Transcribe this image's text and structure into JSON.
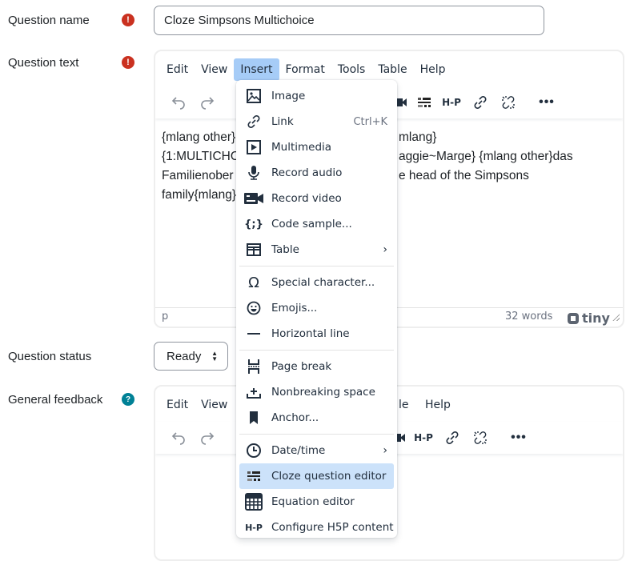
{
  "form": {
    "question_name": {
      "label": "Question name",
      "value": "Cloze Simpsons Multichoice",
      "required_icon": "exclamation-icon"
    },
    "question_text": {
      "label": "Question text",
      "required_icon": "exclamation-icon",
      "menubar": [
        "Edit",
        "View",
        "Insert",
        "Format",
        "Tools",
        "Table",
        "Help"
      ],
      "active_menu": "Insert",
      "content_lines": [
        "{mlang other}",
        "mlang}",
        "{1:MULTICHO",
        "aggie~Marge} {mlang other}das",
        "Familienober",
        "e head of the Simpsons",
        "family{mlang}"
      ],
      "status_path": "p",
      "word_count": "32 words",
      "brand": "tiny"
    },
    "question_status": {
      "label": "Question status",
      "value": "Ready"
    },
    "general_feedback": {
      "label": "General feedback",
      "help_icon": "question-icon",
      "menubar": [
        "Edit",
        "View",
        "le",
        "Help"
      ]
    }
  },
  "insert_menu": {
    "items": [
      {
        "label": "Image",
        "icon": "image-icon"
      },
      {
        "label": "Link",
        "icon": "link-icon",
        "shortcut": "Ctrl+K"
      },
      {
        "label": "Multimedia",
        "icon": "multimedia-icon"
      },
      {
        "label": "Record audio",
        "icon": "microphone-icon"
      },
      {
        "label": "Record video",
        "icon": "video-camera-icon"
      },
      {
        "label": "Code sample...",
        "icon": "code-sample-icon"
      },
      {
        "label": "Table",
        "icon": "table-icon",
        "submenu": true
      },
      {
        "label": "Special character...",
        "icon": "omega-icon"
      },
      {
        "label": "Emojis...",
        "icon": "emoji-icon"
      },
      {
        "label": "Horizontal line",
        "icon": "horizontal-line-icon"
      },
      {
        "label": "Page break",
        "icon": "page-break-icon"
      },
      {
        "label": "Nonbreaking space",
        "icon": "nonbreaking-space-icon"
      },
      {
        "label": "Anchor...",
        "icon": "bookmark-icon"
      },
      {
        "label": "Date/time",
        "icon": "clock-icon",
        "submenu": true
      },
      {
        "label": "Cloze question editor",
        "icon": "cloze-icon",
        "highlighted": true
      },
      {
        "label": "Equation editor",
        "icon": "calculator-icon"
      },
      {
        "label": "Configure H5P content",
        "icon": "h5p-icon"
      }
    ],
    "chevron": "›",
    "h5p_text": "H-P"
  },
  "colors": {
    "required": "#ca3120",
    "help": "#008196",
    "menu_active": "#a6ccf7",
    "item_highlight": "#cce2fa"
  }
}
